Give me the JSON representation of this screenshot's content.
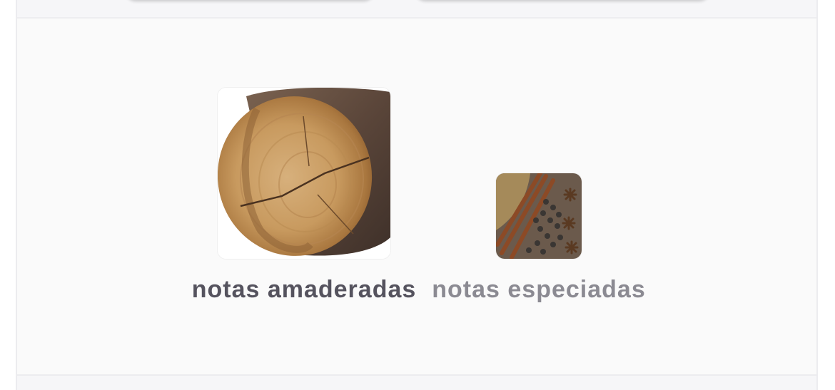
{
  "notes": {
    "items": [
      {
        "label": "notas amaderadas",
        "image": "wood-log-image",
        "selected": true
      },
      {
        "label": "notas especiadas",
        "image": "spices-image",
        "selected": false
      }
    ]
  },
  "colors": {
    "selected_label": "#55535e",
    "unselected_label": "#8b8a92",
    "panel_background": "#fafafa"
  }
}
